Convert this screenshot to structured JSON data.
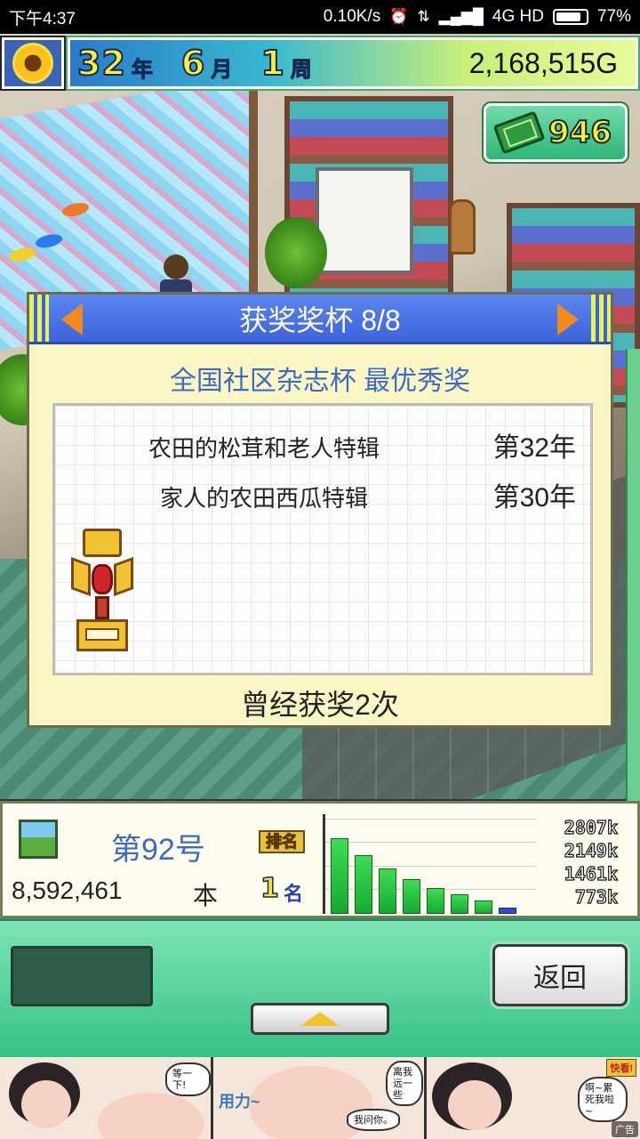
{
  "status_bar": {
    "time": "下午4:37",
    "net_speed": "0.10K/s",
    "network": "4G HD",
    "battery": "77%",
    "icons": [
      "alarm-icon",
      "data-transfer-icon",
      "signal-icon",
      "battery-icon"
    ]
  },
  "hud": {
    "year_num": "32",
    "year_unit": "年",
    "month_num": "6",
    "month_unit": "月",
    "week_num": "1",
    "week_unit": "周",
    "money": "2,168,515G",
    "gem_count": "946"
  },
  "dialog": {
    "title": "获奖奖杯 8/8",
    "award_name": "全国社区杂志杯 最优秀奖",
    "entries": [
      {
        "name": "农田的松茸和老人特辑",
        "year": "第32年"
      },
      {
        "name": "家人的农田西瓜特辑",
        "year": "第30年"
      }
    ],
    "footer": "曾经获奖2次"
  },
  "stats": {
    "issue": "第92号",
    "rank_label": "排名",
    "sales": "8,592,461",
    "sales_unit": "本",
    "rank_value": "1",
    "rank_unit": "名"
  },
  "chart_data": {
    "type": "bar",
    "values": [
      80,
      62,
      48,
      37,
      27,
      21,
      14,
      7
    ],
    "axis_labels": [
      "2807k",
      "2149k",
      "1461k",
      "773k"
    ],
    "colors": {
      "bar": "#22c03e",
      "last_bar": "#2a4fd6"
    }
  },
  "controls": {
    "back_label": "返回"
  },
  "ad": {
    "bubble_1": "等一下!",
    "bubble_2": "离我远一些",
    "bubble_3": "我问你。",
    "bubble_4": "啊~累死我啦~",
    "sfx": "用力~",
    "badge": "快看!",
    "tag": "广告"
  },
  "colors": {
    "accent_blue": "#3d63dc",
    "dialog_bg": "#fbf7c5",
    "hud_yellow": "#ffef3a",
    "control_green": "#35c287"
  }
}
